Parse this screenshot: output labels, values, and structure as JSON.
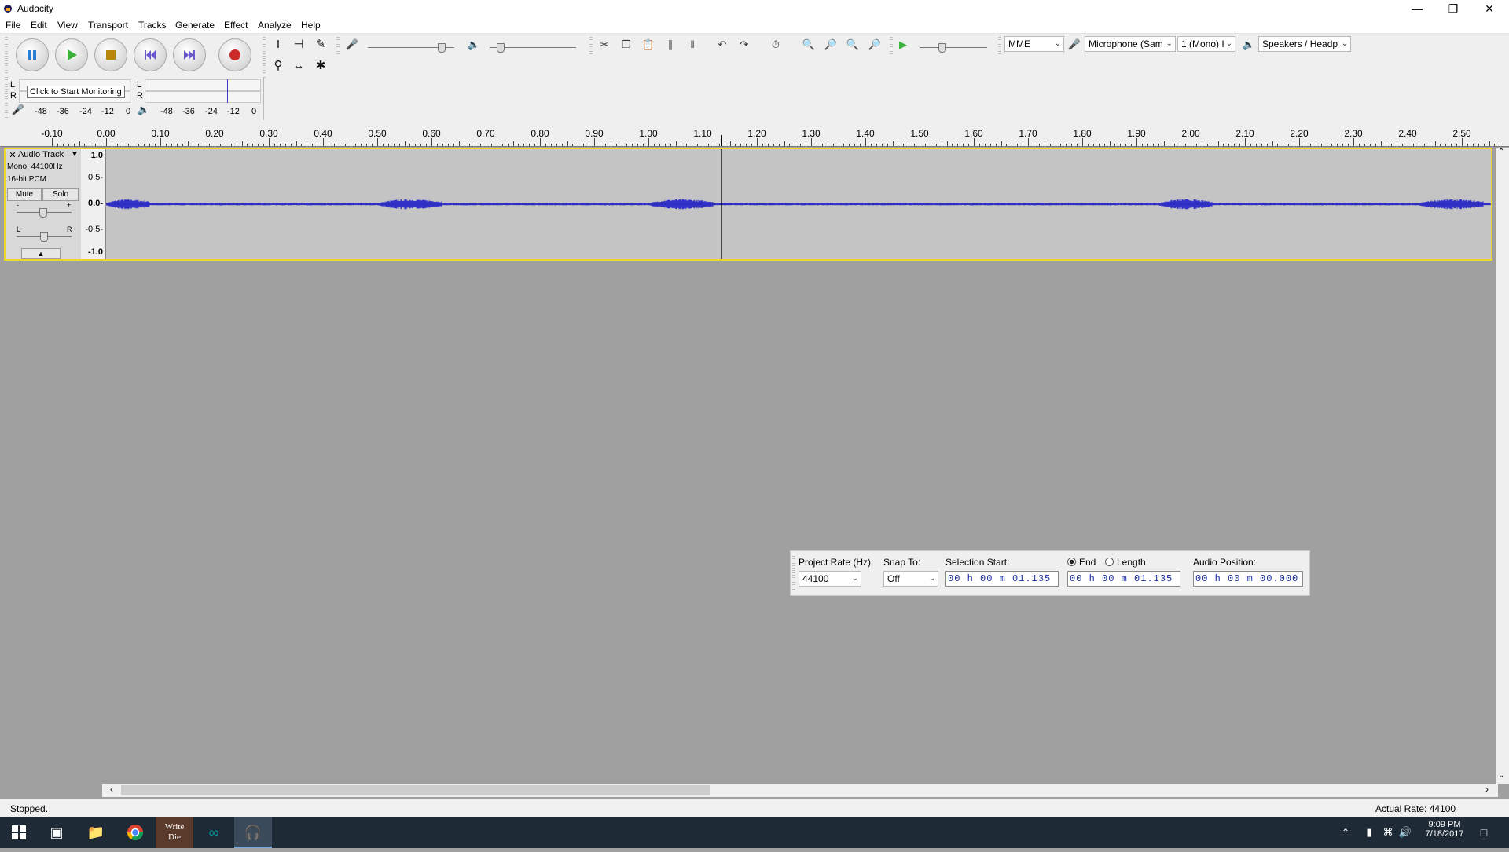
{
  "window": {
    "title": "Audacity"
  },
  "menu": [
    "File",
    "Edit",
    "View",
    "Transport",
    "Tracks",
    "Generate",
    "Effect",
    "Analyze",
    "Help"
  ],
  "meters": {
    "record_tooltip": "Click to Start Monitoring",
    "record_scale": [
      "-48",
      "-36",
      "-24",
      "-12",
      "0"
    ],
    "play_scale": [
      "-48",
      "-36",
      "-24",
      "-12",
      "0"
    ],
    "channel_left": "L",
    "channel_right": "R"
  },
  "device": {
    "host": "MME",
    "microphone": "Microphone (Sam",
    "channels": "1 (Mono) I",
    "speakers": "Speakers / Headp"
  },
  "ruler": {
    "labels": [
      "-0.10",
      "0.00",
      "0.10",
      "0.20",
      "0.30",
      "0.40",
      "0.50",
      "0.60",
      "0.70",
      "0.80",
      "0.90",
      "1.00",
      "1.10",
      "1.20",
      "1.30",
      "1.40",
      "1.50",
      "1.60",
      "1.70",
      "1.80",
      "1.90",
      "2.00",
      "2.10",
      "2.20",
      "2.30",
      "2.40",
      "2.50"
    ]
  },
  "track": {
    "name": "Audio Track",
    "info_line1": "Mono, 44100Hz",
    "info_line2": "16-bit PCM",
    "mute": "Mute",
    "solo": "Solo",
    "gain_minus": "-",
    "gain_plus": "+",
    "pan_left": "L",
    "pan_right": "R",
    "scale": [
      "1.0",
      "0.5-",
      "0.0-",
      "-0.5-",
      "-1.0"
    ],
    "cursor_time": 1.135,
    "loud_segments": [
      [
        0.0,
        0.08
      ],
      [
        0.5,
        0.62
      ],
      [
        1.0,
        1.12
      ],
      [
        1.94,
        2.04
      ],
      [
        2.42,
        2.54
      ]
    ]
  },
  "selection": {
    "project_rate_label": "Project Rate (Hz):",
    "project_rate": "44100",
    "snap_to_label": "Snap To:",
    "snap_to": "Off",
    "selection_start_label": "Selection Start:",
    "selection_start": "00 h 00 m 01.135 s",
    "end_label": "End",
    "length_label": "Length",
    "end_value": "00 h 00 m 01.135 s",
    "audio_position_label": "Audio Position:",
    "audio_position": "00 h 00 m 00.000 s"
  },
  "status": {
    "state": "Stopped.",
    "actual_rate": "Actual Rate: 44100"
  },
  "taskbar": {
    "time": "9:09 PM",
    "date": "7/18/2017",
    "apps": [
      "start-icon",
      "task-view-icon",
      "file-explorer-icon",
      "chrome-icon",
      "write-or-die-icon",
      "arduino-icon",
      "audacity-icon"
    ]
  },
  "colors": {
    "waveform": "#3232c8",
    "track_border": "#ebd829",
    "background": "#a0a0a0"
  }
}
